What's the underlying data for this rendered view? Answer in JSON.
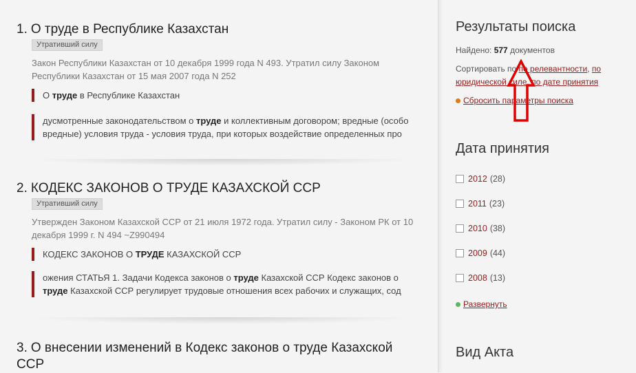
{
  "results": [
    {
      "number": "1.",
      "title": "О труде в Республике Казахстан",
      "badge": "Утративший силу",
      "desc": "Закон Республики Казахстан от 10 декабря 1999 года N 493. Утратил силу Законом Республики Казахстан от 15 мая 2007 года N 252",
      "snip1": {
        "pre": "О ",
        "bold": "труде",
        "post": " в Республике Казахстан"
      },
      "snip2": {
        "pre": "дусмотренные законодательством о ",
        "bold": "труде",
        "post": " и коллективным договором; вредные (особо вредные) условия труда - условия труда, при которых воздействие определенных про"
      }
    },
    {
      "number": "2.",
      "title": "КОДЕКС ЗАКОНОВ О ТРУДЕ КАЗАХСКОЙ ССР",
      "badge": "Утративший силу",
      "desc": "Утвержден Законом Казахской ССР от 21 июля 1972 года. Утратил силу - Законом РК от 10 декабря 1999 г. N 494 ~Z990494",
      "snip1": {
        "pre": "КОДЕКС ЗАКОНОВ О ",
        "bold": "ТРУДЕ",
        "post": " КАЗАХСКОЙ ССР"
      },
      "snip2": {
        "pre": "ожения СТАТЬЯ 1. Задачи Кодекса законов о ",
        "bold": "труде",
        "mid": " Казахской ССР Кодекс законов о ",
        "bold2": "труде",
        "post": " Казахской ССР регулирует трудовые отношения всех рабочих и служащих, сод"
      }
    },
    {
      "number": "3.",
      "title": "О внесении изменений в Кодекс законов о труде Казахской ССР"
    }
  ],
  "sidebar": {
    "search_heading": "Результаты поиска",
    "found_label": "Найдено:",
    "found_count": "577",
    "found_unit": "документов",
    "sort_label": "Сортировать по",
    "sort_relevance": "по релевантности",
    "sort_legal": "по юридической силе",
    "sort_date": "по дате принятия",
    "reset_label": "Сбросить параметры поиска",
    "date_heading": "Дата принятия",
    "years": [
      {
        "year": "2012",
        "count": "(28)"
      },
      {
        "year": "2011",
        "count": "(23)"
      },
      {
        "year": "2010",
        "count": "(38)"
      },
      {
        "year": "2009",
        "count": "(44)"
      },
      {
        "year": "2008",
        "count": "(13)"
      }
    ],
    "expand_label": "Развернуть",
    "act_heading": "Вид Акта"
  },
  "colors": {
    "accent": "#9b1c1c",
    "reset_dot": "#e07b1a",
    "expand_dot": "#5cb85c",
    "arrow": "#e00000"
  },
  "icons": {
    "up_arrow": "up-arrow-icon"
  }
}
